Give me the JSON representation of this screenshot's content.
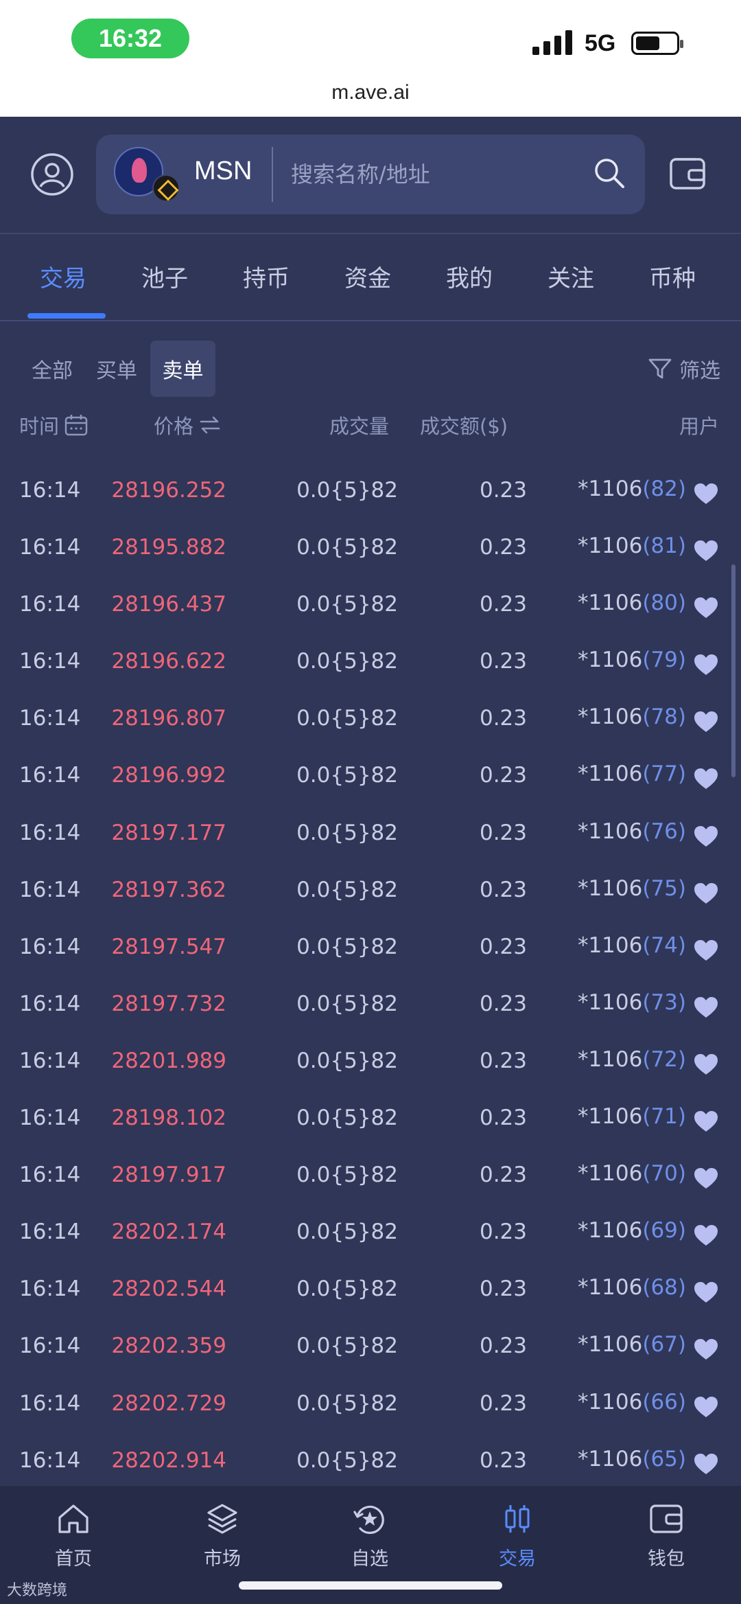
{
  "status_bar": {
    "time": "16:32",
    "network": "5G"
  },
  "browser": {
    "url": "m.ave.ai"
  },
  "header": {
    "token_name": "MSN",
    "search_placeholder": "搜索名称/地址"
  },
  "tabs": [
    "交易",
    "池子",
    "持币",
    "资金",
    "我的",
    "关注",
    "币种"
  ],
  "active_tab": "交易",
  "sub_filters": [
    "全部",
    "买单",
    "卖单"
  ],
  "active_sub_filter": "卖单",
  "filter_label": "筛选",
  "columns": {
    "time": "时间",
    "price": "价格",
    "volume": "成交量",
    "amount": "成交额($)",
    "user": "用户"
  },
  "rows": [
    {
      "time": "16:14",
      "price": "28196.252",
      "volume": "0.0{5}82",
      "amount": "0.23",
      "user": "*1106",
      "count": "(82)"
    },
    {
      "time": "16:14",
      "price": "28195.882",
      "volume": "0.0{5}82",
      "amount": "0.23",
      "user": "*1106",
      "count": "(81)"
    },
    {
      "time": "16:14",
      "price": "28196.437",
      "volume": "0.0{5}82",
      "amount": "0.23",
      "user": "*1106",
      "count": "(80)"
    },
    {
      "time": "16:14",
      "price": "28196.622",
      "volume": "0.0{5}82",
      "amount": "0.23",
      "user": "*1106",
      "count": "(79)"
    },
    {
      "time": "16:14",
      "price": "28196.807",
      "volume": "0.0{5}82",
      "amount": "0.23",
      "user": "*1106",
      "count": "(78)"
    },
    {
      "time": "16:14",
      "price": "28196.992",
      "volume": "0.0{5}82",
      "amount": "0.23",
      "user": "*1106",
      "count": "(77)"
    },
    {
      "time": "16:14",
      "price": "28197.177",
      "volume": "0.0{5}82",
      "amount": "0.23",
      "user": "*1106",
      "count": "(76)"
    },
    {
      "time": "16:14",
      "price": "28197.362",
      "volume": "0.0{5}82",
      "amount": "0.23",
      "user": "*1106",
      "count": "(75)"
    },
    {
      "time": "16:14",
      "price": "28197.547",
      "volume": "0.0{5}82",
      "amount": "0.23",
      "user": "*1106",
      "count": "(74)"
    },
    {
      "time": "16:14",
      "price": "28197.732",
      "volume": "0.0{5}82",
      "amount": "0.23",
      "user": "*1106",
      "count": "(73)"
    },
    {
      "time": "16:14",
      "price": "28201.989",
      "volume": "0.0{5}82",
      "amount": "0.23",
      "user": "*1106",
      "count": "(72)"
    },
    {
      "time": "16:14",
      "price": "28198.102",
      "volume": "0.0{5}82",
      "amount": "0.23",
      "user": "*1106",
      "count": "(71)"
    },
    {
      "time": "16:14",
      "price": "28197.917",
      "volume": "0.0{5}82",
      "amount": "0.23",
      "user": "*1106",
      "count": "(70)"
    },
    {
      "time": "16:14",
      "price": "28202.174",
      "volume": "0.0{5}82",
      "amount": "0.23",
      "user": "*1106",
      "count": "(69)"
    },
    {
      "time": "16:14",
      "price": "28202.544",
      "volume": "0.0{5}82",
      "amount": "0.23",
      "user": "*1106",
      "count": "(68)"
    },
    {
      "time": "16:14",
      "price": "28202.359",
      "volume": "0.0{5}82",
      "amount": "0.23",
      "user": "*1106",
      "count": "(67)"
    },
    {
      "time": "16:14",
      "price": "28202.729",
      "volume": "0.0{5}82",
      "amount": "0.23",
      "user": "*1106",
      "count": "(66)"
    },
    {
      "time": "16:14",
      "price": "28202.914",
      "volume": "0.0{5}82",
      "amount": "0.23",
      "user": "*1106",
      "count": "(65)"
    }
  ],
  "bottom_nav": [
    {
      "label": "首页",
      "icon": "home-icon"
    },
    {
      "label": "市场",
      "icon": "layers-icon"
    },
    {
      "label": "自选",
      "icon": "star-icon"
    },
    {
      "label": "交易",
      "icon": "candlestick-icon"
    },
    {
      "label": "钱包",
      "icon": "wallet-icon"
    }
  ],
  "active_nav": "交易",
  "watermark": "大数跨境",
  "colors": {
    "accent": "#3e7bff",
    "sell_price": "#f0657a",
    "count": "#6f8fe8",
    "favorite": "#b9bff0"
  }
}
